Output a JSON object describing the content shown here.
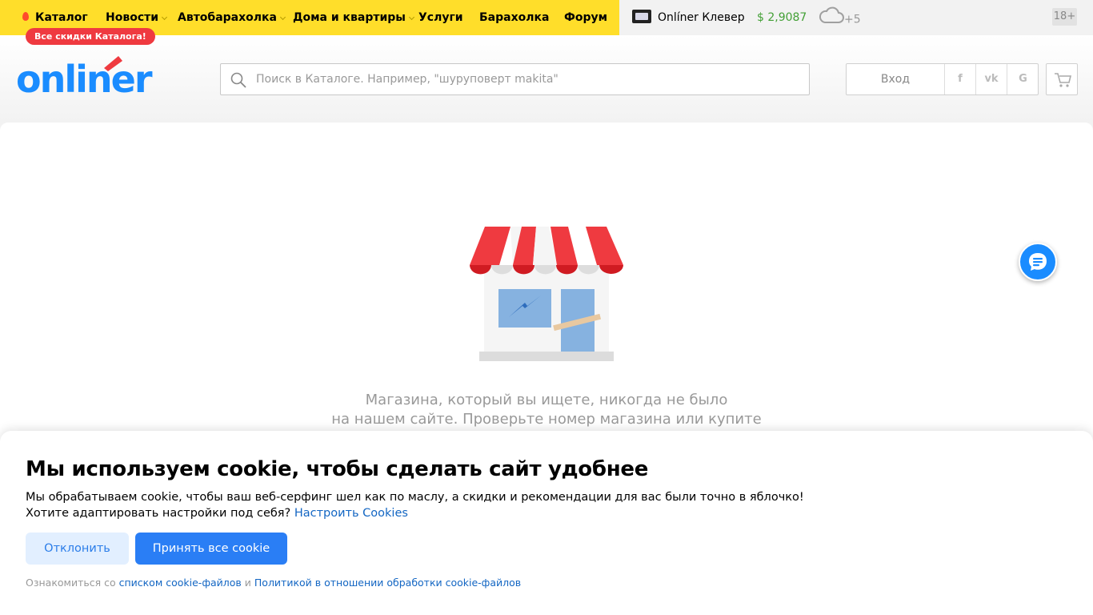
{
  "topbar": {
    "nav": [
      {
        "label": "Каталог"
      },
      {
        "label": "Новости"
      },
      {
        "label": "Автобарахолка"
      },
      {
        "label": "Дома и квартиры"
      },
      {
        "label": "Услуги"
      },
      {
        "label": "Барахолка"
      },
      {
        "label": "Форум"
      }
    ],
    "promo_badge": "Все скидки Каталога!",
    "clever": "Onlíner Клевер",
    "currency": "$ 2,9087",
    "weather": "+5",
    "age": "18+"
  },
  "header": {
    "logo_text": "onliner",
    "search_placeholder": "Поиск в Каталоге. Например, \"шуруповерт makita\"",
    "login": "Вход",
    "social": [
      "f",
      "vk",
      "G"
    ]
  },
  "main": {
    "message_line1": "Магазина, который вы ищете, никогда не было",
    "message_line2": "на нашем сайте. Проверьте номер магазина или купите"
  },
  "cookie": {
    "title": "Мы используем cookie, чтобы сделать сайт удобнее",
    "text1": "Мы обрабатываем cookie, чтобы ваш веб-серфинг шел как по маслу, а скидки и рекомендации для вас были точно в яблочко!",
    "text2": "Хотите адаптировать настройки под себя?",
    "settings_link": "Настроить Cookies",
    "decline": "Отклонить",
    "accept": "Принять все cookie",
    "foot_prefix": "Ознакомиться со",
    "foot_link1": "списком cookie-файлов",
    "foot_and": "и",
    "foot_link2": "Политикой в отношении обработки cookie-файлов"
  },
  "colors": {
    "topbar_yellow": "#ffde2a",
    "brand_blue": "#1a8cff",
    "awning_red": "#ef3a40",
    "accept_blue": "#2a7ef5",
    "currency_green": "#43a036"
  }
}
